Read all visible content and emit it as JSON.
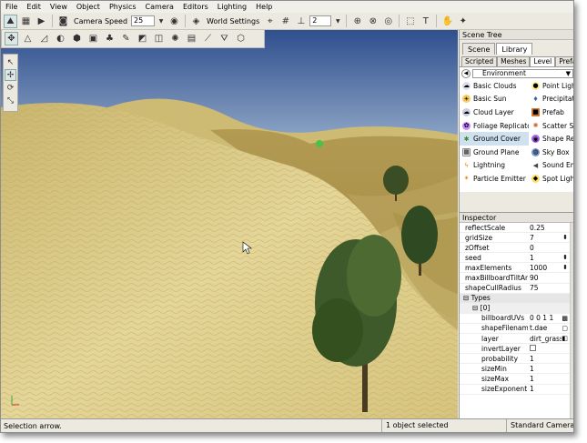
{
  "menu": [
    "File",
    "Edit",
    "View",
    "Object",
    "Physics",
    "Camera",
    "Editors",
    "Lighting",
    "Help"
  ],
  "toolbar": {
    "camera_speed_label": "Camera Speed",
    "camera_speed_value": "25",
    "world_settings_label": "World Settings",
    "numeric_value": "2"
  },
  "scene_tree": {
    "title": "Scene Tree",
    "tabs": [
      "Scene",
      "Library"
    ],
    "active_tab": "Library",
    "subtabs": [
      "Scripted",
      "Meshes",
      "Level",
      "Prefabs"
    ],
    "active_subtab": "Level",
    "category": "Environment",
    "items_left": [
      "Basic Clouds",
      "Basic Sun",
      "Cloud Layer",
      "Foliage Replicator",
      "Ground Cover",
      "Ground Plane",
      "Lightning",
      "Particle Emitter"
    ],
    "items_right": [
      "Point Light",
      "Precipitation",
      "Prefab",
      "Scatter Sky",
      "Shape Replicator",
      "Sky Box",
      "Sound Emitter",
      "Spot Light"
    ],
    "selected": "Ground Cover"
  },
  "inspector": {
    "title": "Inspector",
    "rows": [
      {
        "k": "reflectScale",
        "v": "0.25"
      },
      {
        "k": "gridSize",
        "v": "7"
      },
      {
        "k": "zOffset",
        "v": "0"
      },
      {
        "k": "seed",
        "v": "1"
      },
      {
        "k": "maxElements",
        "v": "1000"
      },
      {
        "k": "maxBillboardTiltAngle",
        "v": "90"
      },
      {
        "k": "shapeCullRadius",
        "v": "75"
      }
    ],
    "group": "Types",
    "subgroup": "[0]",
    "subrows": [
      {
        "k": "billboardUVs",
        "v": "0 0 1 1"
      },
      {
        "k": "shapeFilename",
        "v": "t.dae"
      },
      {
        "k": "layer",
        "v": "dirt_grass"
      },
      {
        "k": "invertLayer",
        "v": ""
      },
      {
        "k": "probability",
        "v": "1"
      },
      {
        "k": "sizeMin",
        "v": "1"
      },
      {
        "k": "sizeMax",
        "v": "1"
      },
      {
        "k": "sizeExponent",
        "v": "1"
      }
    ]
  },
  "status": {
    "left": "Selection arrow.",
    "middle": "1 object selected",
    "right": "Standard Camera"
  },
  "colors": {
    "sky_top": "#2f4f8e",
    "sky_bottom": "#9db3cf",
    "sand_light": "#e4d698",
    "sand_dark": "#b39a52",
    "selection": "#cfe0ee"
  }
}
